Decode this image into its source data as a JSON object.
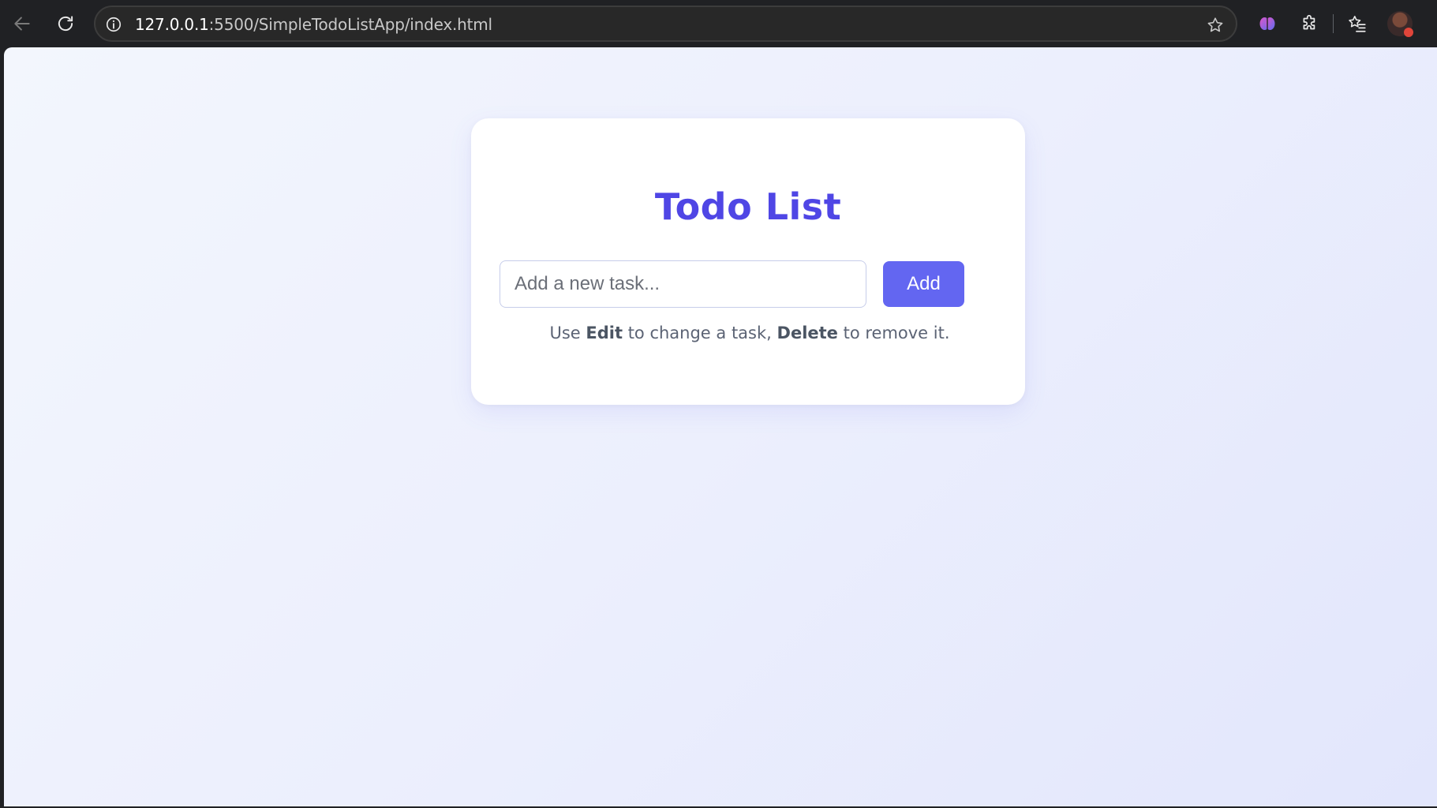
{
  "browser": {
    "url_host": "127.0.0.1",
    "url_rest": ":5500/SimpleTodoListApp/index.html",
    "icons": {
      "back": "back-arrow-icon",
      "reload": "reload-icon",
      "site_info": "info-icon",
      "bookmark": "star-icon",
      "extension_brain": "brain-icon",
      "extensions": "puzzle-icon",
      "favorites": "favorites-icon",
      "profile": "avatar"
    }
  },
  "app": {
    "title": "Todo List",
    "input_placeholder": "Add a new task...",
    "input_value": "",
    "add_label": "Add",
    "hint": {
      "prefix": "Use ",
      "edit": "Edit",
      "middle": " to change a task, ",
      "delete": "Delete",
      "suffix": " to remove it."
    }
  },
  "colors": {
    "accent": "#6366f1",
    "title": "#4f46e5",
    "hint_text": "#5b6374",
    "background_start": "#f3f6fd",
    "background_end": "#e2e6fc"
  }
}
